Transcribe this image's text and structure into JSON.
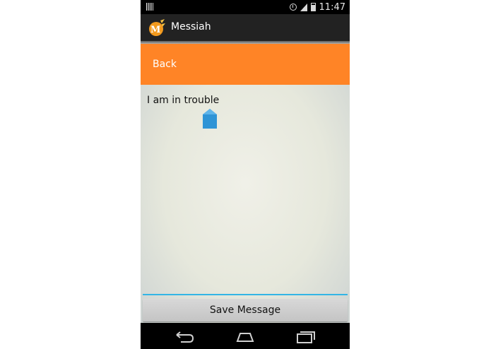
{
  "status_bar": {
    "time": "11:47",
    "icons": [
      "notification-bars-icon",
      "alarm-icon",
      "wifi-icon",
      "battery-icon"
    ]
  },
  "action_bar": {
    "title": "Messiah",
    "icon": "messiah-logo-icon",
    "background": "#222222"
  },
  "back_button": {
    "label": "Back",
    "color": "#ff8426"
  },
  "message_field": {
    "value": "I am in trouble",
    "underline_color": "#33b5e5"
  },
  "save_button": {
    "label": "Save Message"
  },
  "nav_bar": {
    "icons": [
      "back-nav-icon",
      "home-nav-icon",
      "recents-nav-icon"
    ]
  }
}
